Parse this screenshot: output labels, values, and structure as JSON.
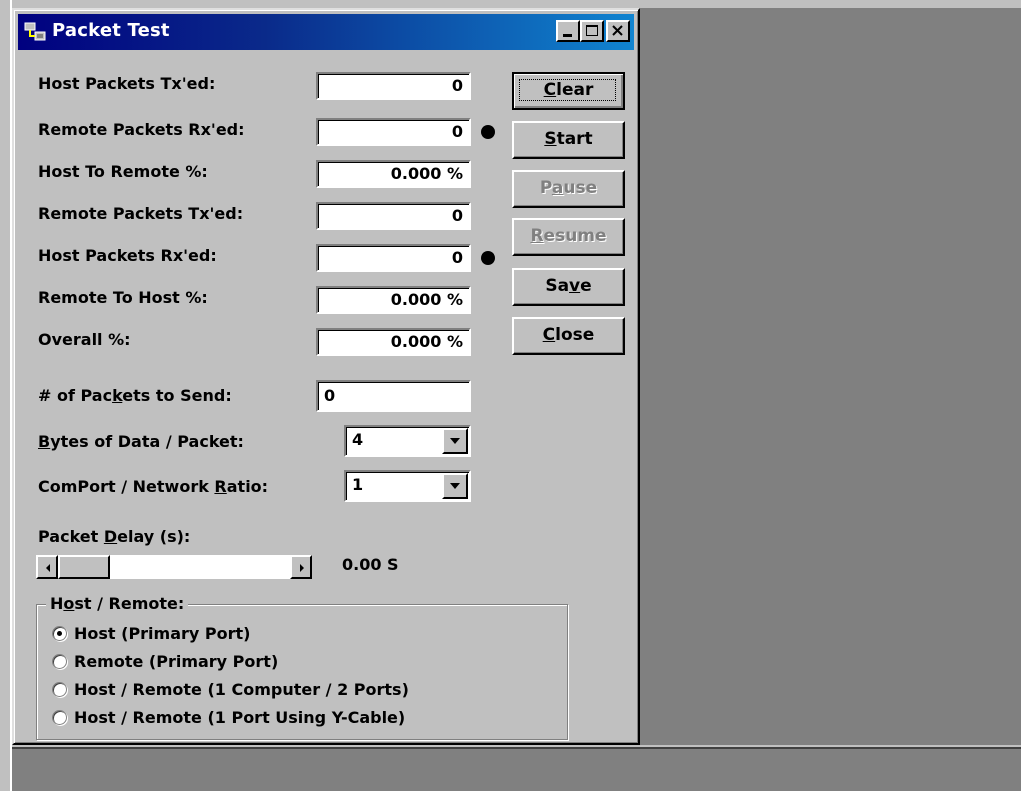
{
  "window": {
    "title": "Packet Test"
  },
  "stats": [
    {
      "label": "Host Packets Tx'ed:",
      "value": "0",
      "indicator": false
    },
    {
      "label": "Remote Packets Rx'ed:",
      "value": "0",
      "indicator": true
    },
    {
      "label": "Host To Remote %:",
      "value": "0.000 %",
      "indicator": false
    },
    {
      "label": "Remote Packets Tx'ed:",
      "value": "0",
      "indicator": false
    },
    {
      "label": "Host Packets Rx'ed:",
      "value": "0",
      "indicator": true
    },
    {
      "label": "Remote To Host %:",
      "value": "0.000 %",
      "indicator": false
    },
    {
      "label": "Overall %:",
      "value": "0.000 %",
      "indicator": false
    }
  ],
  "buttons": {
    "clear": {
      "pre": "",
      "key": "C",
      "post": "lear"
    },
    "start": {
      "pre": "",
      "key": "S",
      "post": "tart"
    },
    "pause": {
      "pre": "P",
      "key": "a",
      "post": "use"
    },
    "resume": {
      "pre": "",
      "key": "R",
      "post": "esume"
    },
    "save": {
      "pre": "Sa",
      "key": "v",
      "post": "e"
    },
    "close": {
      "pre": "",
      "key": "C",
      "post": "lose"
    }
  },
  "settings": {
    "packets_to_send": {
      "pre": "# of Pac",
      "key": "k",
      "post": "ets to Send:",
      "value": "0"
    },
    "bytes_per_packet": {
      "pre": "",
      "key": "B",
      "post": "ytes of Data / Packet:",
      "value": "4"
    },
    "comport_ratio": {
      "pre": "ComPort / Network ",
      "key": "R",
      "post": "atio:",
      "value": "1"
    }
  },
  "delay": {
    "pre": "Packet ",
    "key": "D",
    "post": "elay (s):",
    "readout": "0.00 S",
    "level": 0.0
  },
  "host_remote": {
    "legend_pre": "H",
    "legend_key": "o",
    "legend_post": "st / Remote:",
    "options": [
      {
        "label": "Host (Primary Port)",
        "selected": true
      },
      {
        "label": "Remote (Primary Port)",
        "selected": false
      },
      {
        "label": "Host / Remote (1 Computer / 2 Ports)",
        "selected": false
      },
      {
        "label": "Host / Remote (1 Port Using Y-Cable)",
        "selected": false
      }
    ]
  },
  "colors": {
    "face": "#c0c0c0",
    "desktop": "#808080",
    "title_start": "#000080",
    "title_end": "#1084d0",
    "disabled_text": "#808080"
  }
}
